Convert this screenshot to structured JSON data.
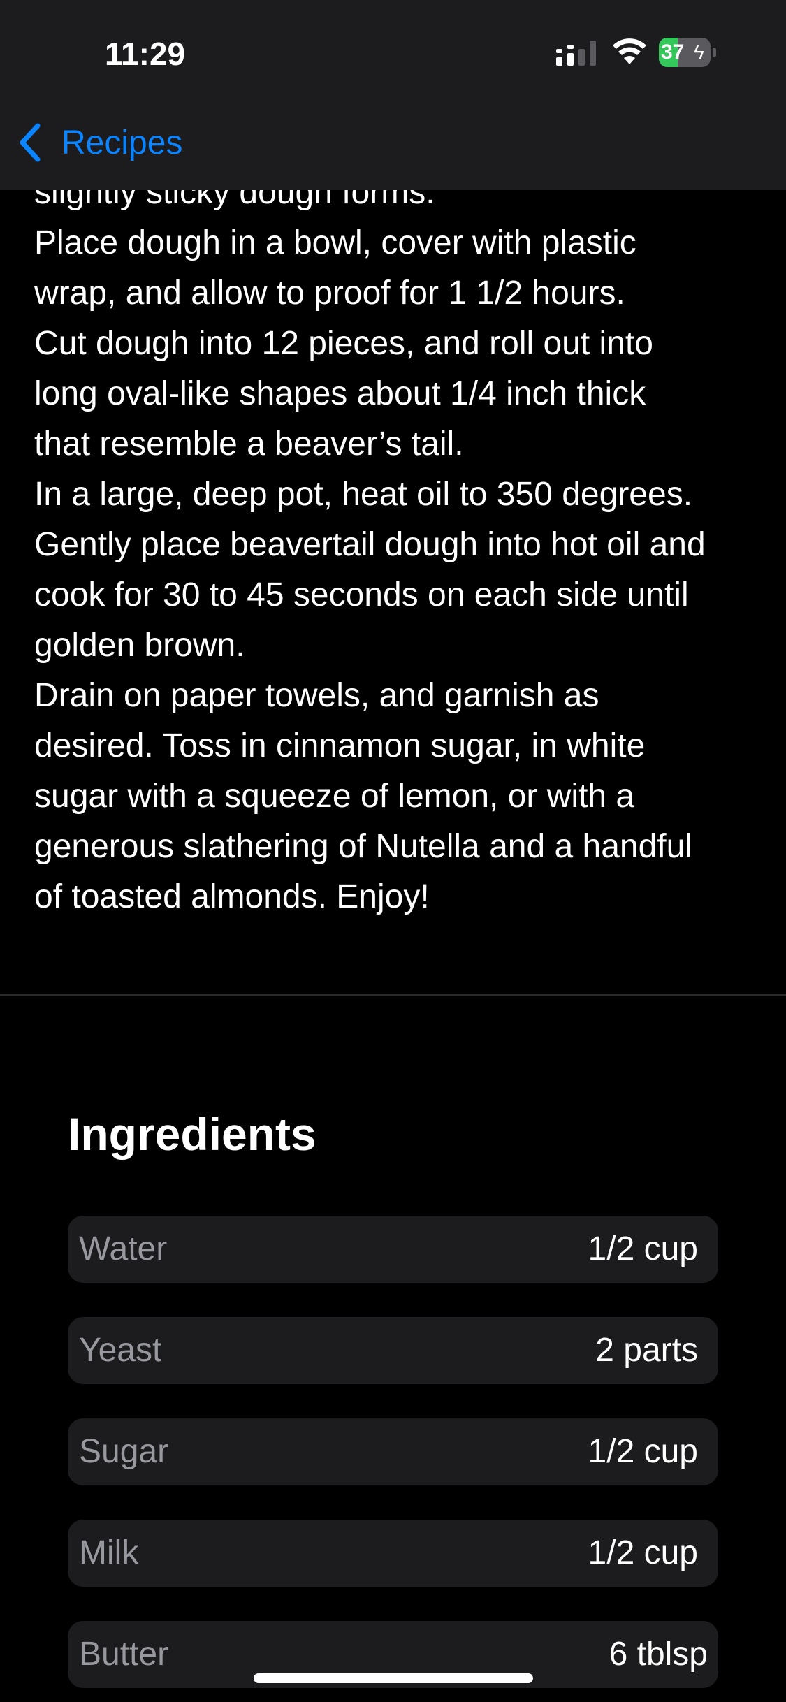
{
  "status_bar": {
    "time": "11:29",
    "battery_level": "37",
    "battery_percent": 37,
    "battery_color": "#34c759",
    "icons": [
      "signal-icon",
      "wifi-icon",
      "battery-icon",
      "charging-bolt-icon"
    ]
  },
  "nav": {
    "back_label": "Recipes",
    "back_icon": "chevron-left-icon",
    "accent_color": "#0a84ff"
  },
  "instructions": {
    "lines": [
      "slightly sticky dough forms.",
      "Place dough in a bowl, cover with plastic",
      "wrap, and allow to proof for 1 1/2 hours.",
      "Cut dough into 12 pieces, and roll out into",
      "long oval-like shapes about 1/4 inch thick",
      "that resemble a beaver’s tail.",
      "In a large, deep pot, heat oil to 350 degrees.",
      "Gently place beavertail dough into hot oil and",
      "cook for 30 to 45 seconds on each side until",
      "golden brown.",
      "Drain on paper towels, and garnish as",
      "desired. Toss in cinnamon sugar, in white",
      "sugar with a squeeze of lemon, or with a",
      "generous slathering of Nutella and a handful",
      "of toasted almonds. Enjoy!"
    ]
  },
  "ingredients": {
    "title": "Ingredients",
    "items": [
      {
        "name": "Water",
        "amount": "1/2 cup"
      },
      {
        "name": "Yeast",
        "amount": "2 parts"
      },
      {
        "name": "Sugar",
        "amount": "1/2 cup"
      },
      {
        "name": "Milk",
        "amount": "1/2 cup"
      },
      {
        "name": "Butter",
        "amount": "6 tblsp"
      }
    ]
  }
}
